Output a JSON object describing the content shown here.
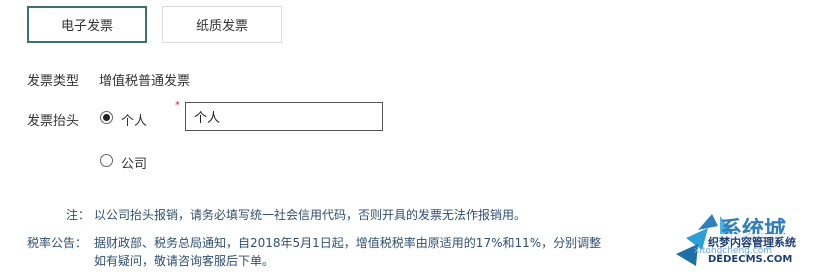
{
  "tabs": [
    {
      "label": "电子发票",
      "active": true
    },
    {
      "label": "纸质发票",
      "active": false
    }
  ],
  "invoice_type": {
    "label": "发票类型",
    "value": "增值税普通发票"
  },
  "invoice_header": {
    "label": "发票抬头",
    "required_mark": "*",
    "options": [
      {
        "label": "个人",
        "checked": true
      },
      {
        "label": "公司",
        "checked": false
      }
    ],
    "input_value": "个人"
  },
  "notice": {
    "note_label": "注：",
    "note_text": "以公司抬头报销，请务必填写统一社会信用代码，否则开具的发票无法作报销用。",
    "tax_label": "税率公告：",
    "tax_line1": "据财政部、税务总局通知，自2018年5月1日起，增值税税率由原适用的17%和11%，分别调整",
    "tax_line2": "如有疑问，敬请咨询客服后下单。"
  },
  "watermark": {
    "site_cn": "系统城",
    "site_url": "xitongcheng.com",
    "brand": "织梦内容管理系统",
    "brand_url": "DEDECMS.COM"
  },
  "colors": {
    "active_border": "#3f6f72",
    "required": "#e02020",
    "note_text": "#2f4f6f"
  }
}
